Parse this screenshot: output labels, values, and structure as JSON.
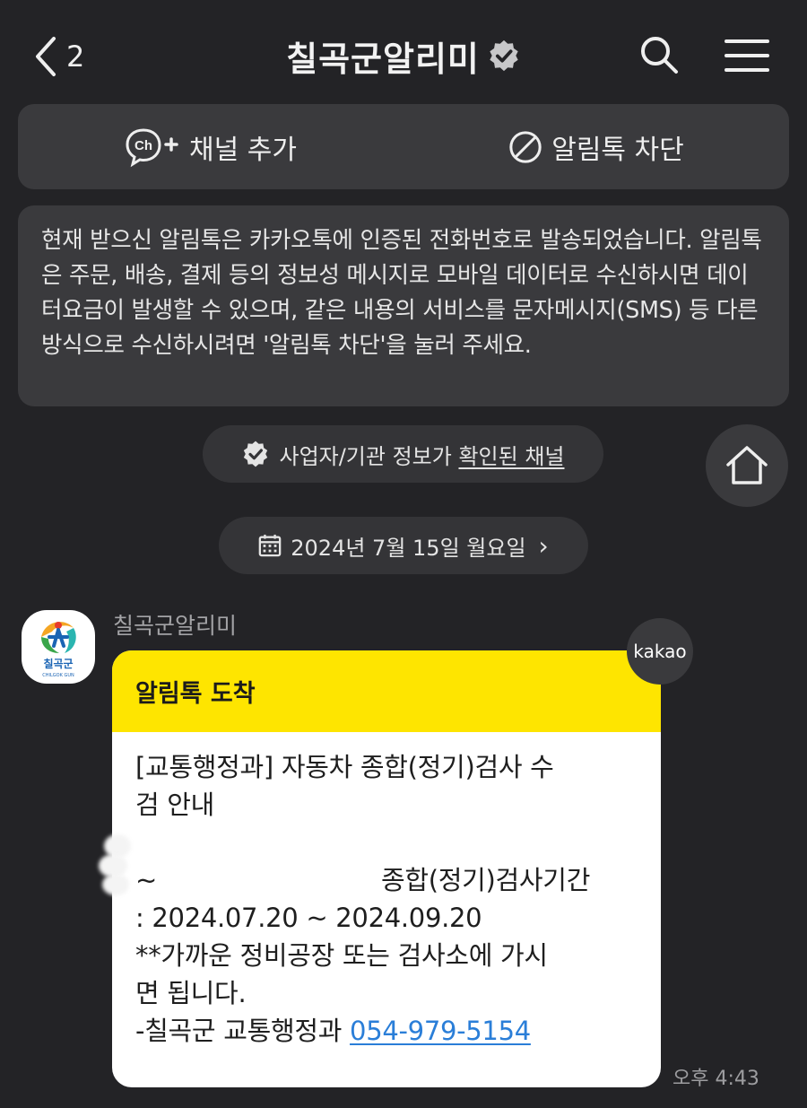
{
  "header": {
    "back_count": "2",
    "title": "칠곡군알리미",
    "icons": [
      "back-chevron-icon",
      "verified-badge-icon",
      "search-icon",
      "hamburger-menu-icon"
    ]
  },
  "actions": {
    "add_channel": "채널 추가",
    "block": "알림톡 차단"
  },
  "notice": {
    "text": "현재 받으신 알림톡은 카카오톡에 인증된 전화번호로 발송되었습니다. 알림톡은 주문, 배송, 결제 등의 정보성 메시지로 모바일 데이터로 수신하시면 데이터요금이 발생할 수 있으며, 같은 내용의 서비스를 문자메시지(SMS) 등 다른 방식으로 수신하시려면 '알림톡 차단'을 눌러 주세요."
  },
  "verified_channel": {
    "prefix": "사업자/기관 정보가 ",
    "link": "확인된 채널"
  },
  "date_pill": {
    "label": "2024년 7월 15일 월요일",
    "chevron": "›"
  },
  "message": {
    "sender": "칠곡군알리미",
    "avatar_text": "칠곡군",
    "avatar_sub": "CHILGOK GUN",
    "badge": "kakao",
    "header": "알림톡 도착",
    "title": "[교통행정과] 자동차 종합(정기)검사 수검 안내",
    "tilde": "~",
    "period_label": "종합(정기)검사기간",
    "period": ": 2024.07.20 ~ 2024.09.20",
    "note_1": "**가까운 정비공장 또는 검사소에 가시",
    "note_2": "면 됩니다.",
    "sign": "-칠곡군 교통행정과 ",
    "phone": "054-979-5154",
    "time": "오후 4:43"
  },
  "colors": {
    "background": "#232326",
    "card": "#3a3a3d",
    "bubble_header": "#fee500",
    "link": "#2a7ed8"
  }
}
